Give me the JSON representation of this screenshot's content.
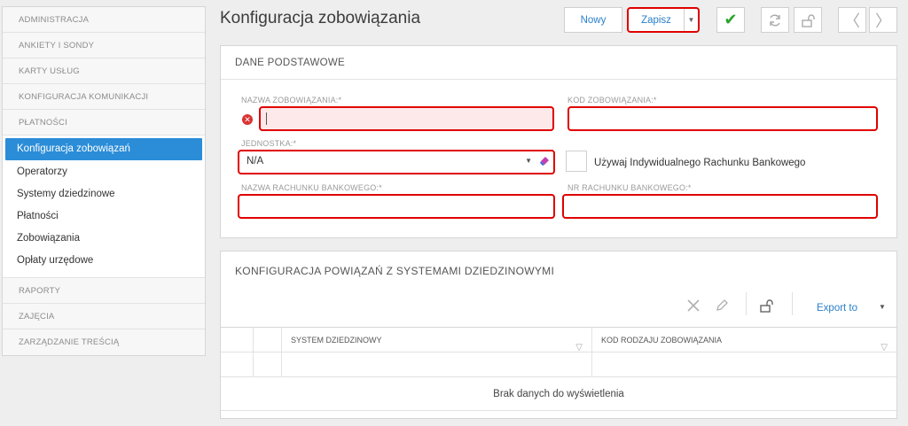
{
  "sidebar": {
    "sections_top": [
      {
        "label": "ADMINISTRACJA"
      },
      {
        "label": "ANKIETY I SONDY"
      },
      {
        "label": "KARTY USŁUG"
      },
      {
        "label": "KONFIGURACJA KOMUNIKACJI"
      },
      {
        "label": "PŁATNOŚCI"
      }
    ],
    "items": [
      {
        "label": "Konfiguracja zobowiązań",
        "active": true
      },
      {
        "label": "Operatorzy"
      },
      {
        "label": "Systemy dziedzinowe"
      },
      {
        "label": "Płatności"
      },
      {
        "label": "Zobowiązania"
      },
      {
        "label": "Opłaty urzędowe"
      }
    ],
    "sections_bottom": [
      {
        "label": "RAPORTY"
      },
      {
        "label": "ZAJĘCIA"
      },
      {
        "label": "ZARZĄDZANIE TREŚCIĄ"
      }
    ]
  },
  "header": {
    "title": "Konfiguracja zobowiązania",
    "new_label": "Nowy",
    "save_label": "Zapisz"
  },
  "basic": {
    "title": "DANE PODSTAWOWE",
    "name_label": "NAZWA ZOBOWIĄZANIA:*",
    "name_value": "",
    "code_label": "KOD ZOBOWIĄZANIA:*",
    "code_value": "",
    "unit_label": "JEDNOSTKA:*",
    "unit_value": "N/A",
    "individual_account_label": "Używaj Indywidualnego Rachunku Bankowego",
    "bank_name_label": "NAZWA RACHUNKU BANKOWEGO:*",
    "bank_name_value": "",
    "bank_number_label": "NR RACHUNKU BANKOWEGO:*",
    "bank_number_value": ""
  },
  "links": {
    "title": "KONFIGURACJA POWIĄZAŃ Z SYSTEMAMI DZIEDZINOWYMI",
    "export_label": "Export to",
    "columns": [
      "SYSTEM DZIEDZINOWY",
      "KOD RODZAJU ZOBOWIĄZANIA"
    ],
    "empty_text": "Brak danych do wyświetlenia"
  },
  "colors": {
    "accent": "#2b8dd8",
    "error_border": "#e00000",
    "error_fill": "#fde8ea",
    "ok_green": "#2aa52a"
  }
}
